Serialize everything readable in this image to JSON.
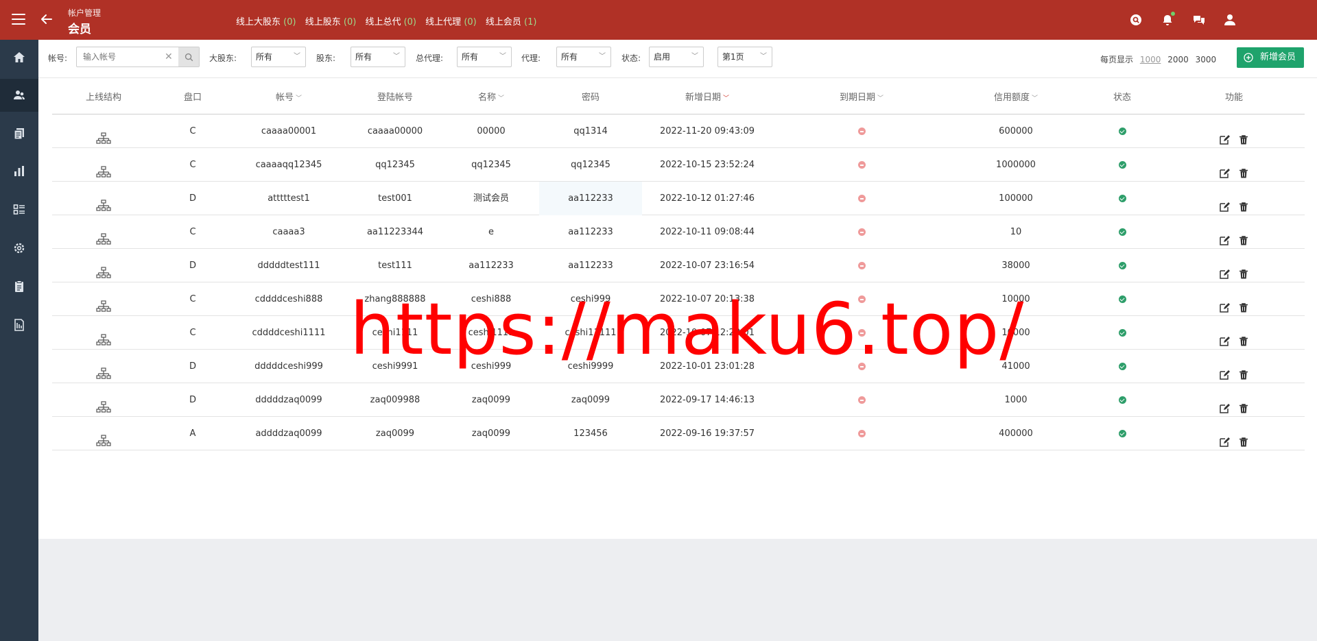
{
  "header": {
    "breadcrumb": "帐户管理",
    "title": "会员",
    "online": [
      {
        "label": "线上大股东",
        "count": "(0)"
      },
      {
        "label": "线上股东",
        "count": "(0)"
      },
      {
        "label": "线上总代",
        "count": "(0)"
      },
      {
        "label": "线上代理",
        "count": "(0)"
      },
      {
        "label": "线上会员",
        "count": "(1)"
      }
    ],
    "icons": [
      "search-icon",
      "bell-icon",
      "chat-icon",
      "user-icon"
    ]
  },
  "sidebar": {
    "items": [
      "home-icon",
      "users-icon",
      "documents-icon",
      "chart-icon",
      "list-icon",
      "settings-icon",
      "clipboard-icon",
      "report-icon"
    ],
    "active_index": 1
  },
  "filters": {
    "account_label": "帐号:",
    "account_placeholder": "输入帐号",
    "major_shareholder_label": "大股东:",
    "major_shareholder_value": "所有",
    "shareholder_label": "股东:",
    "shareholder_value": "所有",
    "general_agent_label": "总代理:",
    "general_agent_value": "所有",
    "agent_label": "代理:",
    "agent_value": "所有",
    "status_label": "状态:",
    "status_value": "启用",
    "page_value": "第1页",
    "per_page_label": "每页显示",
    "per_page_options": [
      "1000",
      "2000",
      "3000"
    ],
    "per_page_selected": "1000",
    "add_button": "新增会员"
  },
  "table": {
    "columns": [
      "上线结构",
      "盘口",
      "帐号",
      "登陆帐号",
      "名称",
      "密码",
      "新增日期",
      "到期日期",
      "信用额度",
      "状态",
      "功能"
    ],
    "rows": [
      {
        "plate": "C",
        "account": "caaaa00001",
        "login": "caaaa00000",
        "name": "00000",
        "password": "qq1314",
        "created": "2022-11-20 09:43:09",
        "credit": "600000"
      },
      {
        "plate": "C",
        "account": "caaaaqq12345",
        "login": "qq12345",
        "name": "qq12345",
        "password": "qq12345",
        "created": "2022-10-15 23:52:24",
        "credit": "1000000"
      },
      {
        "plate": "D",
        "account": "atttttest1",
        "login": "test001",
        "name": "测试会员",
        "password": "aa112233",
        "created": "2022-10-12 01:27:46",
        "credit": "100000"
      },
      {
        "plate": "C",
        "account": "caaaa3",
        "login": "aa11223344",
        "name": "e",
        "password": "aa112233",
        "created": "2022-10-11 09:08:44",
        "credit": "10"
      },
      {
        "plate": "D",
        "account": "dddddtest111",
        "login": "test111",
        "name": "aa112233",
        "password": "aa112233",
        "created": "2022-10-07 23:16:54",
        "credit": "38000"
      },
      {
        "plate": "C",
        "account": "cddddceshi888",
        "login": "zhang888888",
        "name": "ceshi888",
        "password": "ceshi999",
        "created": "2022-10-07 20:13:38",
        "credit": "10000"
      },
      {
        "plate": "C",
        "account": "cddddceshi1111",
        "login": "ceshi1111",
        "name": "ceshi1111",
        "password": "ceshi11111",
        "created": "2022-10-07 12:28:01",
        "credit": "10000"
      },
      {
        "plate": "D",
        "account": "dddddceshi999",
        "login": "ceshi9991",
        "name": "ceshi999",
        "password": "ceshi9999",
        "created": "2022-10-01 23:01:28",
        "credit": "41000"
      },
      {
        "plate": "D",
        "account": "dddddzaq0099",
        "login": "zaq009988",
        "name": "zaq0099",
        "password": "zaq0099",
        "created": "2022-09-17 14:46:13",
        "credit": "1000"
      },
      {
        "plate": "A",
        "account": "addddzaq0099",
        "login": "zaq0099",
        "name": "zaq0099",
        "password": "123456",
        "created": "2022-09-16 19:37:57",
        "credit": "400000"
      }
    ]
  },
  "watermark": "https://maku6.top/",
  "colors": {
    "header": "#b03126",
    "sidebar": "#2b3a4a",
    "add_button": "#1fa36c",
    "status_ok": "#2e9e6a",
    "expiry": "#ef9a9a"
  }
}
